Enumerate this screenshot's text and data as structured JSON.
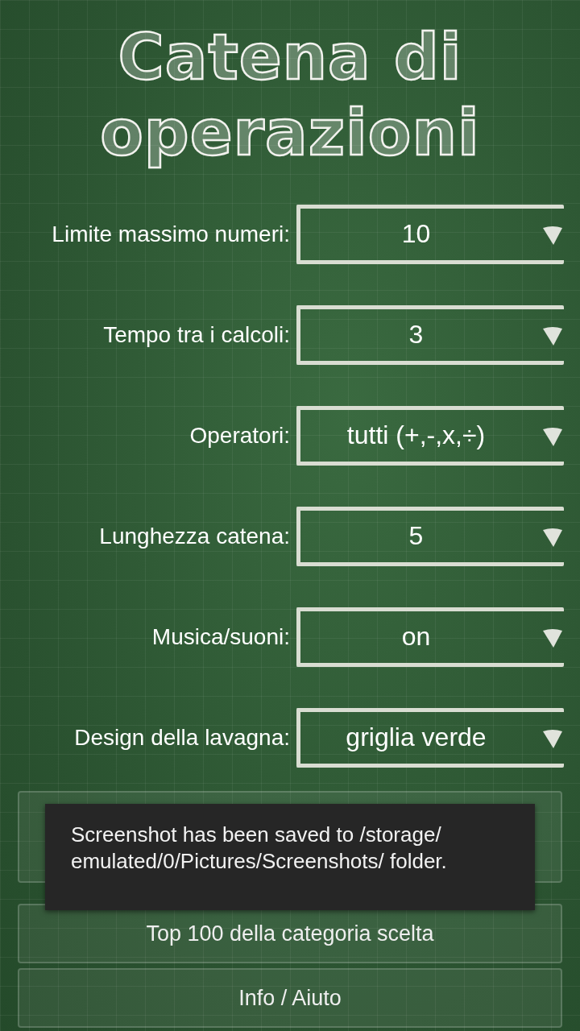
{
  "title": [
    "Catena di",
    "operazioni"
  ],
  "settings": [
    {
      "label": "Limite massimo numeri:",
      "value": "10"
    },
    {
      "label": "Tempo tra i calcoli:",
      "value": "3"
    },
    {
      "label": "Operatori:",
      "value": "tutti (+,-,x,÷)"
    },
    {
      "label": "Lunghezza catena:",
      "value": "5"
    },
    {
      "label": "Musica/suoni:",
      "value": "on"
    },
    {
      "label": "Design della lavagna:",
      "value": "griglia verde"
    }
  ],
  "buttons": [
    {
      "kind": "start"
    },
    {
      "kind": "plain",
      "label": "Top 100 della categoria scelta"
    },
    {
      "kind": "plain",
      "label": "Info / Aiuto"
    }
  ],
  "toast": "Screenshot has been saved to /storage/ emulated/0/Pictures/Screenshots/ folder."
}
